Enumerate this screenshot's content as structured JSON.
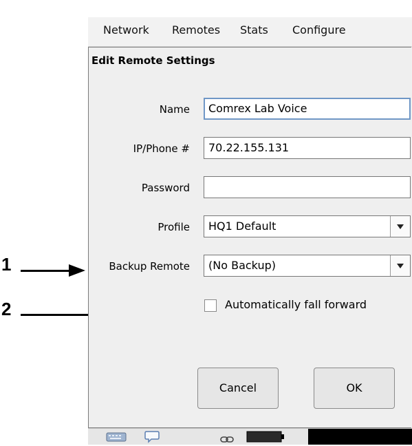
{
  "menu": {
    "items": [
      "Network",
      "Remotes",
      "Stats",
      "Configure"
    ]
  },
  "panel": {
    "title": "Edit Remote Settings"
  },
  "form": {
    "name_label": "Name",
    "name_value": "Comrex Lab Voice",
    "ip_label": "IP/Phone #",
    "ip_value": "70.22.155.131",
    "password_label": "Password",
    "password_value": "",
    "profile_label": "Profile",
    "profile_value": "HQ1 Default",
    "backup_label": "Backup Remote",
    "backup_value": "(No Backup)",
    "fall_forward_label": "Automatically fall forward",
    "fall_forward_checked": false
  },
  "buttons": {
    "cancel": "Cancel",
    "ok": "OK"
  },
  "status_bar": {
    "icons": [
      "keyboard-icon",
      "chat-bubble-icon",
      "link-icon",
      "battery-icon"
    ]
  },
  "annotations": {
    "callout_1": "1",
    "callout_2": "2"
  },
  "colors": {
    "focus_border": "#6f97c6",
    "panel_bg": "#efefef"
  }
}
